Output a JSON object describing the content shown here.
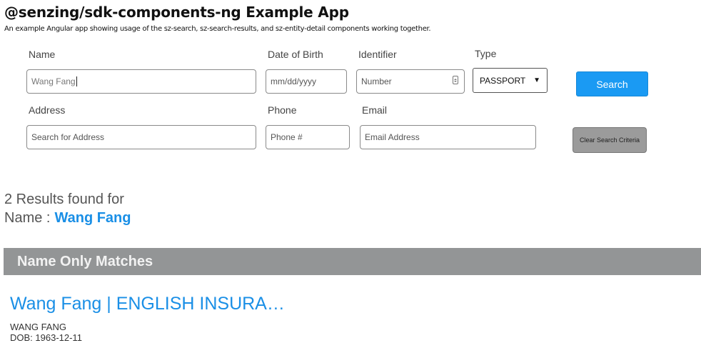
{
  "app": {
    "title": "@senzing/sdk-components-ng Example App",
    "subtitle": "An example Angular app showing usage of the sz-search, sz-search-results, and sz-entity-detail components working together."
  },
  "search": {
    "name": {
      "label": "Name",
      "value": "Wang Fang"
    },
    "dob": {
      "label": "Date of Birth",
      "placeholder": "mm/dd/yyyy"
    },
    "identifier": {
      "label": "Identifier",
      "placeholder": "Number"
    },
    "type": {
      "label": "Type",
      "selected": "PASSPORT"
    },
    "address": {
      "label": "Address",
      "placeholder": "Search for Address"
    },
    "phone": {
      "label": "Phone",
      "placeholder": "Phone #"
    },
    "email": {
      "label": "Email",
      "placeholder": "Email Address"
    },
    "search_button": "Search",
    "clear_button": "Clear Search Criteria"
  },
  "results": {
    "count_text": "2 Results found for",
    "criteria_label": "Name :",
    "criteria_value": "Wang Fang",
    "section_title": "Name Only Matches",
    "items": [
      {
        "title": "Wang Fang | ENGLISH INSURA…",
        "name": "WANG FANG",
        "dob": "DOB: 1963-12-11"
      }
    ]
  },
  "colors": {
    "accent": "#1a9af3",
    "link": "#1a8fe6",
    "section_bg": "#939596"
  }
}
